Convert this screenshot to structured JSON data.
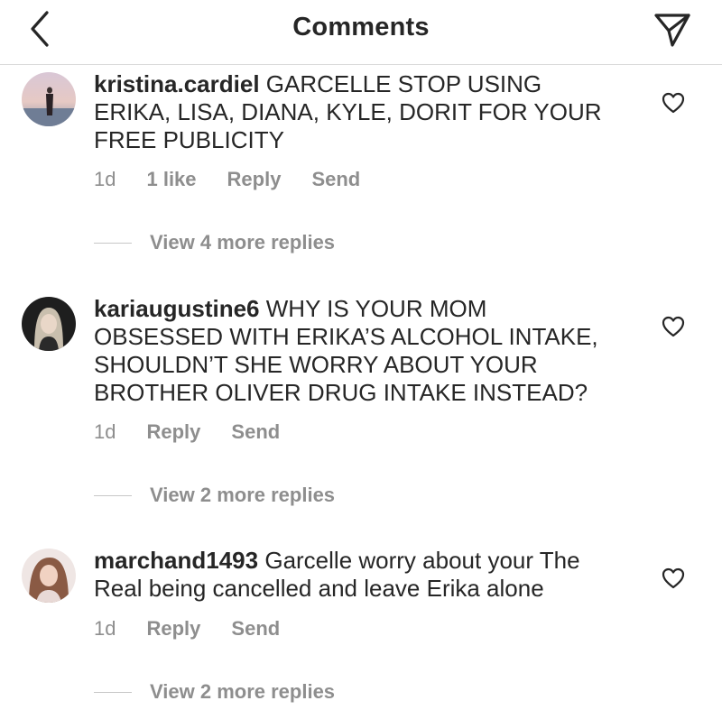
{
  "header": {
    "title": "Comments"
  },
  "comments": [
    {
      "username": "kristina.cardiel",
      "text_lines": [
        "GARCELLE STOP USING",
        "ERIKA, LISA, DIANA, KYLE, DORIT FOR YOUR",
        "FREE PUBLICITY"
      ],
      "time": "1d",
      "likes": "1 like",
      "reply": "Reply",
      "send": "Send",
      "view_replies": "View 4 more replies"
    },
    {
      "username": "kariaugustine6",
      "text_lines": [
        "WHY IS YOUR MOM",
        "OBSESSED WITH ERIKA’S ALCOHOL INTAKE,",
        "SHOULDN’T SHE WORRY ABOUT YOUR",
        "BROTHER OLIVER DRUG INTAKE INSTEAD?"
      ],
      "time": "1d",
      "reply": "Reply",
      "send": "Send",
      "view_replies": "View 2 more replies"
    },
    {
      "username": "marchand1493",
      "text_lines": [
        "Garcelle worry about your The",
        "Real being cancelled and leave Erika alone"
      ],
      "time": "1d",
      "reply": "Reply",
      "send": "Send",
      "view_replies": "View 2 more replies"
    }
  ]
}
